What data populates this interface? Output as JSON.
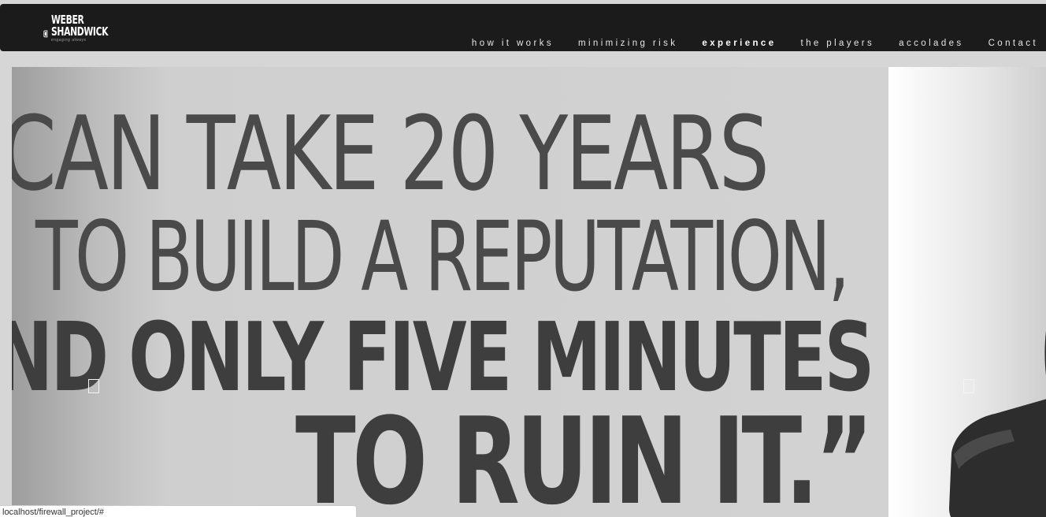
{
  "brand": {
    "name_line1": "WEBER",
    "name_line2": "SHANDWICK",
    "tagline": "engaging always"
  },
  "nav": {
    "items": [
      {
        "label": "how it works",
        "active": false
      },
      {
        "label": "minimizing risk",
        "active": false
      },
      {
        "label": "experience",
        "active": true
      },
      {
        "label": "the players",
        "active": false
      },
      {
        "label": "accolades",
        "active": false
      },
      {
        "label": "Contact",
        "active": false
      }
    ]
  },
  "slider": {
    "quote": {
      "line1": "CAN TAKE 20 YEARS",
      "line2": "TO BUILD A REPUTATION,",
      "line3": "ND ONLY FIVE MINUTES",
      "line4": "TO RUIN IT.”"
    },
    "prev_icon": "arrow-left-icon",
    "next_icon": "arrow-right-icon"
  },
  "status": {
    "url": "localhost/firewall_project/#"
  },
  "colors": {
    "topbar": "#1b1b1b",
    "page_background": "#d6d6d6",
    "quote_text": "#404040"
  }
}
